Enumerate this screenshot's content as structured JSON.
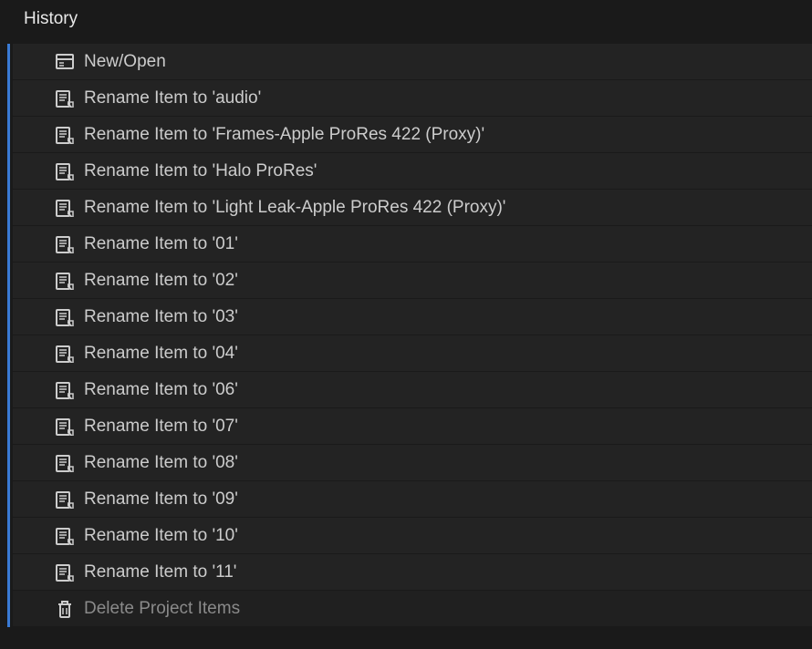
{
  "panel": {
    "title": "History"
  },
  "history": {
    "items": [
      {
        "label": "New/Open",
        "icon": "new-open-icon",
        "dimmed": false
      },
      {
        "label": "Rename Item to 'audio'",
        "icon": "rename-icon",
        "dimmed": false
      },
      {
        "label": "Rename Item to 'Frames-Apple ProRes 422 (Proxy)'",
        "icon": "rename-icon",
        "dimmed": false
      },
      {
        "label": "Rename Item to 'Halo ProRes'",
        "icon": "rename-icon",
        "dimmed": false
      },
      {
        "label": "Rename Item to 'Light Leak-Apple ProRes 422 (Proxy)'",
        "icon": "rename-icon",
        "dimmed": false
      },
      {
        "label": "Rename Item to '01'",
        "icon": "rename-icon",
        "dimmed": false
      },
      {
        "label": "Rename Item to '02'",
        "icon": "rename-icon",
        "dimmed": false
      },
      {
        "label": "Rename Item to '03'",
        "icon": "rename-icon",
        "dimmed": false
      },
      {
        "label": "Rename Item to '04'",
        "icon": "rename-icon",
        "dimmed": false
      },
      {
        "label": "Rename Item to '06'",
        "icon": "rename-icon",
        "dimmed": false
      },
      {
        "label": "Rename Item to '07'",
        "icon": "rename-icon",
        "dimmed": false
      },
      {
        "label": "Rename Item to '08'",
        "icon": "rename-icon",
        "dimmed": false
      },
      {
        "label": "Rename Item to '09'",
        "icon": "rename-icon",
        "dimmed": false
      },
      {
        "label": "Rename Item to '10'",
        "icon": "rename-icon",
        "dimmed": false
      },
      {
        "label": "Rename Item to '11'",
        "icon": "rename-icon",
        "dimmed": false
      },
      {
        "label": "Delete Project Items",
        "icon": "trash-icon",
        "dimmed": true
      }
    ]
  }
}
